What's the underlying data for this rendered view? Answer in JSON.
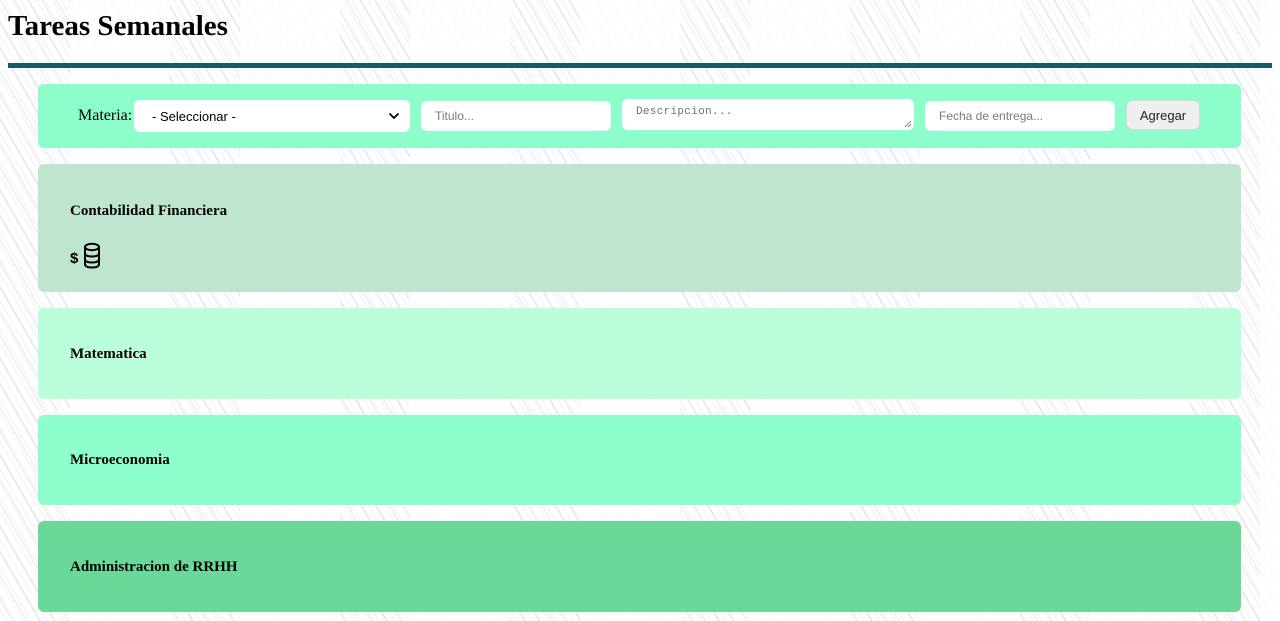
{
  "page": {
    "title": "Tareas Semanales"
  },
  "form": {
    "materia_label": "Materia:",
    "materia_select": {
      "selected": "- Seleccionar -",
      "options": [
        "- Seleccionar -"
      ]
    },
    "titulo_placeholder": "Titulo...",
    "descripcion_placeholder": "Descripcion...",
    "fecha_placeholder": "Fecha de entrega...",
    "add_button_label": "Agregar"
  },
  "subjects": [
    {
      "name": "Contabilidad Financiera",
      "color": "#bfe5cf",
      "icon": "money-coins-icon"
    },
    {
      "name": "Matematica",
      "color": "#bbfedb",
      "icon": ""
    },
    {
      "name": "Microeconomia",
      "color": "#8dfdcb",
      "icon": ""
    },
    {
      "name": "Administracion de RRHH",
      "color": "#69d898",
      "icon": ""
    }
  ],
  "colors": {
    "title_rule": "#165c66",
    "form_bar": "#8cfdcb"
  }
}
